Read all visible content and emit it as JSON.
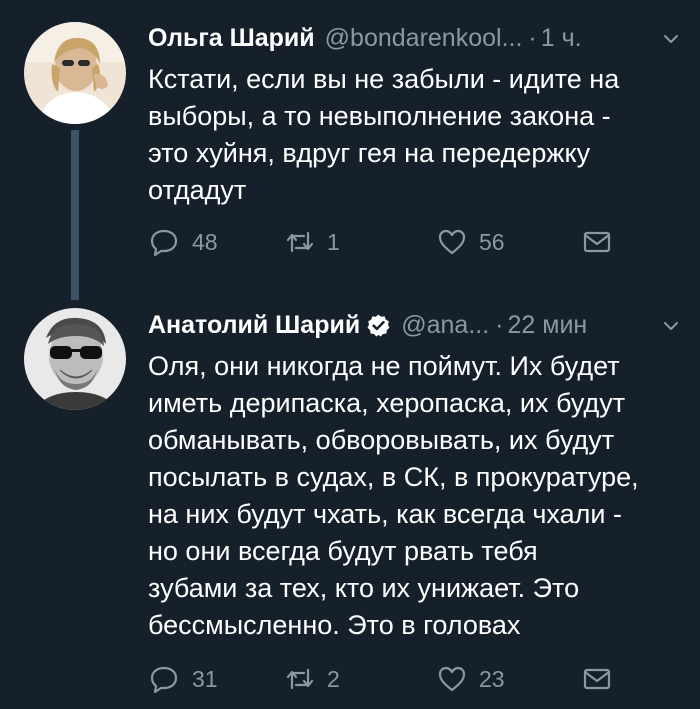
{
  "colors": {
    "background": "#15202b",
    "secondary_text": "#8899a6",
    "thread_line": "#3d5466",
    "verified": "#ffffff"
  },
  "tweets": [
    {
      "name": "Ольга Шарий",
      "handle": "@bondarenkool...",
      "separator": "·",
      "time": "1 ч.",
      "text": "Кстати, если вы не забыли - идите на\nвыборы, а то невыполнение закона -\nэто хуйня, вдруг гея на передержку\nотдадут",
      "replies": "48",
      "retweets": "1",
      "likes": "56",
      "icons": {
        "reply": "reply-icon",
        "retweet": "retweet-icon",
        "like": "heart-icon",
        "dm": "envelope-icon",
        "menu": "chevron-down-icon"
      }
    },
    {
      "name": "Анатолий Шарий",
      "verified": true,
      "handle": "@ana...",
      "separator": "·",
      "time": "22 мин",
      "text": "Оля, они никогда не поймут. Их будет\nиметь дерипаска, херопаска, их будут\nобманывать, обворовывать, их будут\nпосылать в судах, в СК, в прокуратуре,\nна них будут чхать, как всегда чхали -\nно они всегда будут рвать тебя\nзубами за тех, кто их унижает. Это\nбессмысленно. Это в головах",
      "replies": "31",
      "retweets": "2",
      "likes": "23",
      "icons": {
        "reply": "reply-icon",
        "retweet": "retweet-icon",
        "like": "heart-icon",
        "dm": "envelope-icon",
        "menu": "chevron-down-icon"
      }
    }
  ]
}
